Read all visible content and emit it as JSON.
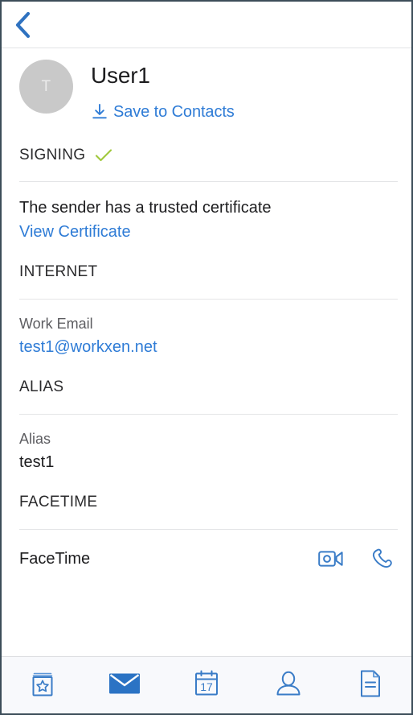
{
  "colors": {
    "accent_blue": "#2f7cd6",
    "icon_blue": "#3a7cc7",
    "check_green": "#a0c83c",
    "avatar_gray": "#c9c9c9",
    "text_dark": "#1d1d1f",
    "text_muted": "#5d5d61",
    "divider": "#e4e5e7",
    "tabbar_bg": "#f8f9fc",
    "frame_border": "#3c4d59"
  },
  "navbar": {
    "back_icon": "chevron-left-icon",
    "back_label": ""
  },
  "contact": {
    "avatar_initial": "T",
    "name": "User1",
    "save_to_contacts_label": "Save to Contacts",
    "save_icon": "download-arrow-icon"
  },
  "sections": [
    {
      "key": "signing",
      "title": "SIGNING",
      "badge_icon": "green-check-icon",
      "status_text": "The sender has a trusted certificate",
      "link_text": "View Certificate"
    },
    {
      "key": "internet",
      "title": "INTERNET",
      "field_label": "Work Email",
      "field_value": "test1@workxen.net"
    },
    {
      "key": "alias",
      "title": "ALIAS",
      "field_label": "Alias",
      "field_value": "test1"
    },
    {
      "key": "facetime",
      "title": "FACETIME",
      "row_label": "FaceTime",
      "actions": [
        {
          "icon": "video-camera-icon",
          "label": "FaceTime Video"
        },
        {
          "icon": "phone-handset-icon",
          "label": "FaceTime Audio"
        }
      ]
    }
  ],
  "tabbar": {
    "items": [
      {
        "icon": "favorites-book-icon",
        "label": "Favorites",
        "active": false
      },
      {
        "icon": "mail-envelope-icon",
        "label": "Mail",
        "active": true
      },
      {
        "icon": "calendar-icon",
        "label": "Calendar",
        "active": false,
        "day": "17"
      },
      {
        "icon": "person-icon",
        "label": "Contacts",
        "active": false
      },
      {
        "icon": "document-icon",
        "label": "Files",
        "active": false
      }
    ]
  }
}
